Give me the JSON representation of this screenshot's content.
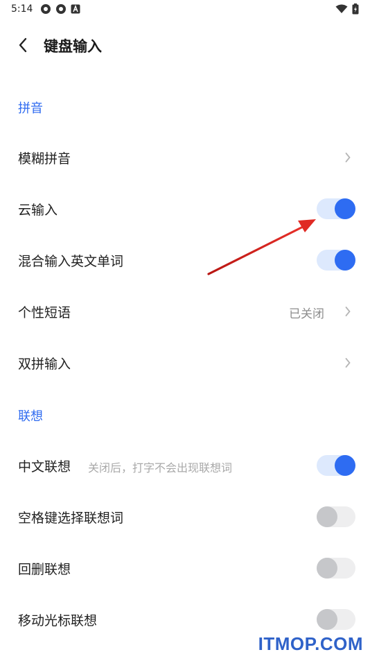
{
  "status_bar": {
    "time": "5:14"
  },
  "app_bar": {
    "title": "键盘输入"
  },
  "sections": [
    {
      "header": "拼音"
    },
    {
      "header": "联想"
    }
  ],
  "rows": [
    {
      "label": "模糊拼音",
      "control": "chevron"
    },
    {
      "label": "云输入",
      "control": "toggle",
      "checked": true
    },
    {
      "label": "混合输入英文单词",
      "control": "toggle",
      "checked": true
    },
    {
      "label": "个性短语",
      "value": "已关闭",
      "control": "chevron"
    },
    {
      "label": "双拼输入",
      "control": "chevron"
    },
    {
      "label": "中文联想",
      "hint": "关闭后，打字不会出现联想词",
      "control": "toggle",
      "checked": true
    },
    {
      "label": "空格键选择联想词",
      "control": "toggle",
      "checked": false
    },
    {
      "label": "回删联想",
      "control": "toggle",
      "checked": false
    },
    {
      "label": "移动光标联想",
      "control": "toggle",
      "checked": false
    }
  ],
  "watermark": "ITMOP.COM",
  "colors": {
    "accent": "#2e6cf2",
    "annotation_arrow": "#d9241f"
  }
}
